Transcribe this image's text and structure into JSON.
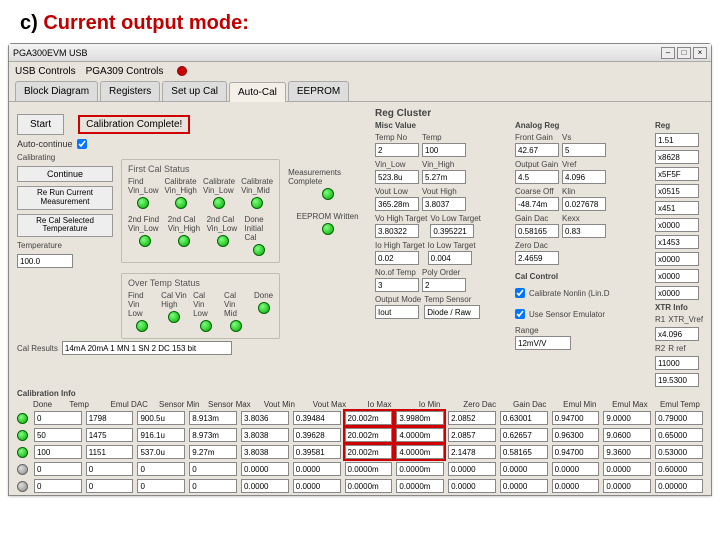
{
  "heading_prefix": "c) ",
  "heading_main": "Current output mode:",
  "window_title": "PGA300EVM USB",
  "menubar": [
    "USB Controls",
    "PGA309 Controls"
  ],
  "tabs": [
    "Block Diagram",
    "Registers",
    "Set up Cal",
    "Auto-Cal",
    "EEPROM"
  ],
  "start_btn": "Start",
  "cal_complete": "Calibration Complete!",
  "auto_continue_lbl": "Auto-continue",
  "calibrating_lbl": "Calibrating",
  "continue_btn": "Continue",
  "rerun_btn": "Re Run Current Measurement",
  "recal_btn": "Re Cal Selected Temperature",
  "temperature_lbl": "Temperature",
  "temperature_val": "100.0",
  "cal_results_lbl": "Cal Results",
  "cal_results_val": "14mA 20mA 1 MN 1 SN 2 DC 153 bit",
  "calibration_info_lbl": "Calibration Info",
  "first_cal_status": {
    "title": "First Cal Status",
    "steps": [
      "Find Vin_Low",
      "Calibrate Vin_High",
      "Calibrate Vin_Low",
      "Calibrate Vin_Mid"
    ]
  },
  "second_cal_status": {
    "steps": [
      "2nd Find Vin_Low",
      "2nd Cal Vin_High",
      "2nd Cal Vin_Low",
      "Done Initial Cal"
    ]
  },
  "over_temp_status": {
    "title": "Over Temp Status",
    "steps": [
      "Find Vin Low",
      "Cal Vin High",
      "Cal Vin Low",
      "Cal Vin Mid",
      "Done"
    ]
  },
  "measurements_complete": "Measurements Complete",
  "eeprom_written": "EEPROM Written",
  "reg_cluster_title": "Reg Cluster",
  "misc_value_title": "Misc Value",
  "analog_reg_title": "Analog Reg",
  "reg_title": "Reg",
  "misc": {
    "temp_no_lbl": "Temp No",
    "temp_no": "2",
    "temp_lbl": "Temp",
    "temp": "100",
    "vin_low_lbl": "Vin_Low",
    "vin_low": "523.8u",
    "vin_high_lbl": "Vin_High",
    "vin_high": "5.27m",
    "vout_low_lbl": "Vout Low",
    "vout_low": "365.28m",
    "vout_high_lbl": "Vout High",
    "vout_high": "3.8037",
    "vo_high_t_lbl": "Vo High Target",
    "vo_high_t": "3.80322",
    "vo_low_t_lbl": "Vo Low Target",
    "vo_low_t": "0.395221",
    "io_high_t_lbl": "Io High Target",
    "io_high_t": "0.02",
    "io_low_t_lbl": "Io Low Target",
    "io_low_t": "0.004",
    "no_temp_lbl": "No.of Temp",
    "no_temp": "3",
    "poly_order_lbl": "Poly Order",
    "poly_order": "2",
    "output_mode_lbl": "Output Mode",
    "output_mode": "Iout",
    "temp_sensor_lbl": "Temp Sensor",
    "temp_sensor": "Diode / Raw"
  },
  "analog": {
    "front_gain_lbl": "Front Gain",
    "front_gain": "42.67",
    "vs_lbl": "Vs",
    "vs": "5",
    "output_gain_lbl": "Output Gain",
    "output_gain": "4.5",
    "vref_lbl": "Vref",
    "vref": "4.096",
    "coarse_off_lbl": "Coarse Off",
    "coarse_off": "-48.74m",
    "klin_lbl": "Klin",
    "klin": "0.027678",
    "gain_dac_lbl": "Gain Dac",
    "gain_dac": "0.58165",
    "kexx_lbl": "Kexx",
    "kexx": "0.83",
    "zero_dac_lbl": "Zero Dac",
    "zero_dac": "2.4659"
  },
  "cal_control_title": "Cal Control",
  "cal_control": {
    "cal_nonlin_lbl": "Calibrate Nonlin (Lin.D",
    "use_sensor_lbl": "Use Sensor Emulator",
    "range_lbl": "Range",
    "range": "12mV/V"
  },
  "xtr_info_title": "XTR Info",
  "xtr": {
    "r1_lbl": "R1",
    "r1v_lbl": "XTR_Vref",
    "r2_lbl": "R2",
    "rref_lbl": "R ref"
  },
  "reg": {
    "r0": "1.51",
    "r1": "x8628",
    "r2": "x5F5F",
    "r3": "x0515",
    "r4": "x451",
    "r5": "x0000",
    "r6": "x1453",
    "r7": "x0000",
    "r8": "x0000",
    "r9": "x0000",
    "r10": "x4.096",
    "r11": "11000",
    "r12": "19.5300"
  },
  "cal_table": {
    "headers": [
      "Done",
      "Temp",
      "Emul DAC",
      "Sensor Min",
      "Sensor Max",
      "Vout Min",
      "Vout Max",
      "Io Max",
      "Io Min",
      "Zero Dac",
      "Gain Dac",
      "Emul Min",
      "Emul Max",
      "Emul Temp"
    ],
    "rows": [
      {
        "on": true,
        "v": [
          "0",
          "1798",
          "900.5u",
          "8.913m",
          "3.8036",
          "0.39484",
          "20.002m",
          "3.9980m",
          "2.0852",
          "0.63001",
          "0.94700",
          "9.0000",
          "0.79000"
        ]
      },
      {
        "on": true,
        "v": [
          "50",
          "1475",
          "916.1u",
          "8.973m",
          "3.8038",
          "0.39628",
          "20.002m",
          "4.0000m",
          "2.0857",
          "0.62657",
          "0.96300",
          "9.0600",
          "0.65000"
        ]
      },
      {
        "on": true,
        "v": [
          "100",
          "1151",
          "537.0u",
          "9.27m",
          "3.8038",
          "0.39581",
          "20.002m",
          "4.0000m",
          "2.1478",
          "0.58165",
          "0.94700",
          "9.3600",
          "0.53000"
        ]
      },
      {
        "on": false,
        "v": [
          "0",
          "0",
          "0",
          "0",
          "0.0000",
          "0.0000",
          "0.0000m",
          "0.0000m",
          "0.0000",
          "0.0000",
          "0.0000",
          "0.0000",
          "0.60000"
        ]
      },
      {
        "on": false,
        "v": [
          "0",
          "0",
          "0",
          "0",
          "0.0000",
          "0.0000",
          "0.0000m",
          "0.0000m",
          "0.0000",
          "0.0000",
          "0.0000",
          "0.0000",
          "0.00000"
        ]
      }
    ]
  }
}
